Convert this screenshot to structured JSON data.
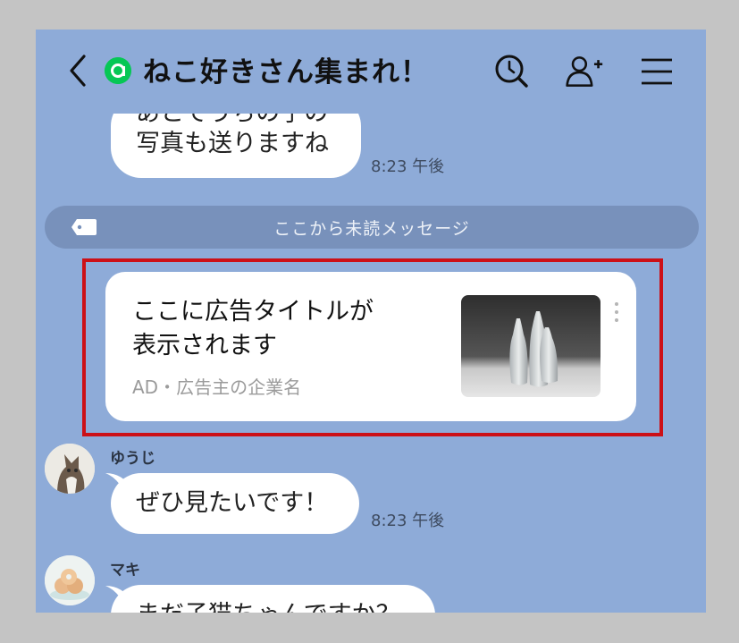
{
  "header": {
    "title": "ねこ好きさん集まれ！",
    "back_icon": "chevron-left-icon",
    "group_icon": "open-chat-icon",
    "search_icon": "search-icon",
    "add_friend_icon": "add-friend-icon",
    "menu_icon": "hamburger-menu-icon"
  },
  "messages": [
    {
      "text_line1": "あとでうちの子の",
      "text_line2": "写真も送りますね",
      "time": "8:23 午後"
    }
  ],
  "unread_divider": {
    "label": "ここから未読メッセージ"
  },
  "ad": {
    "title_line1": "ここに広告タイトルが",
    "title_line2": "表示されます",
    "sponsor": "AD・広告主の企業名"
  },
  "chat": [
    {
      "sender": "ゆうじ",
      "text": "ぜひ見たいです！",
      "time": "8:23 午後"
    },
    {
      "sender": "マキ",
      "text": "まだ子猫ちゃんですか？"
    }
  ],
  "colors": {
    "background": "#8eabd8",
    "ad_highlight": "#cc1017",
    "group_icon": "#06c755"
  }
}
